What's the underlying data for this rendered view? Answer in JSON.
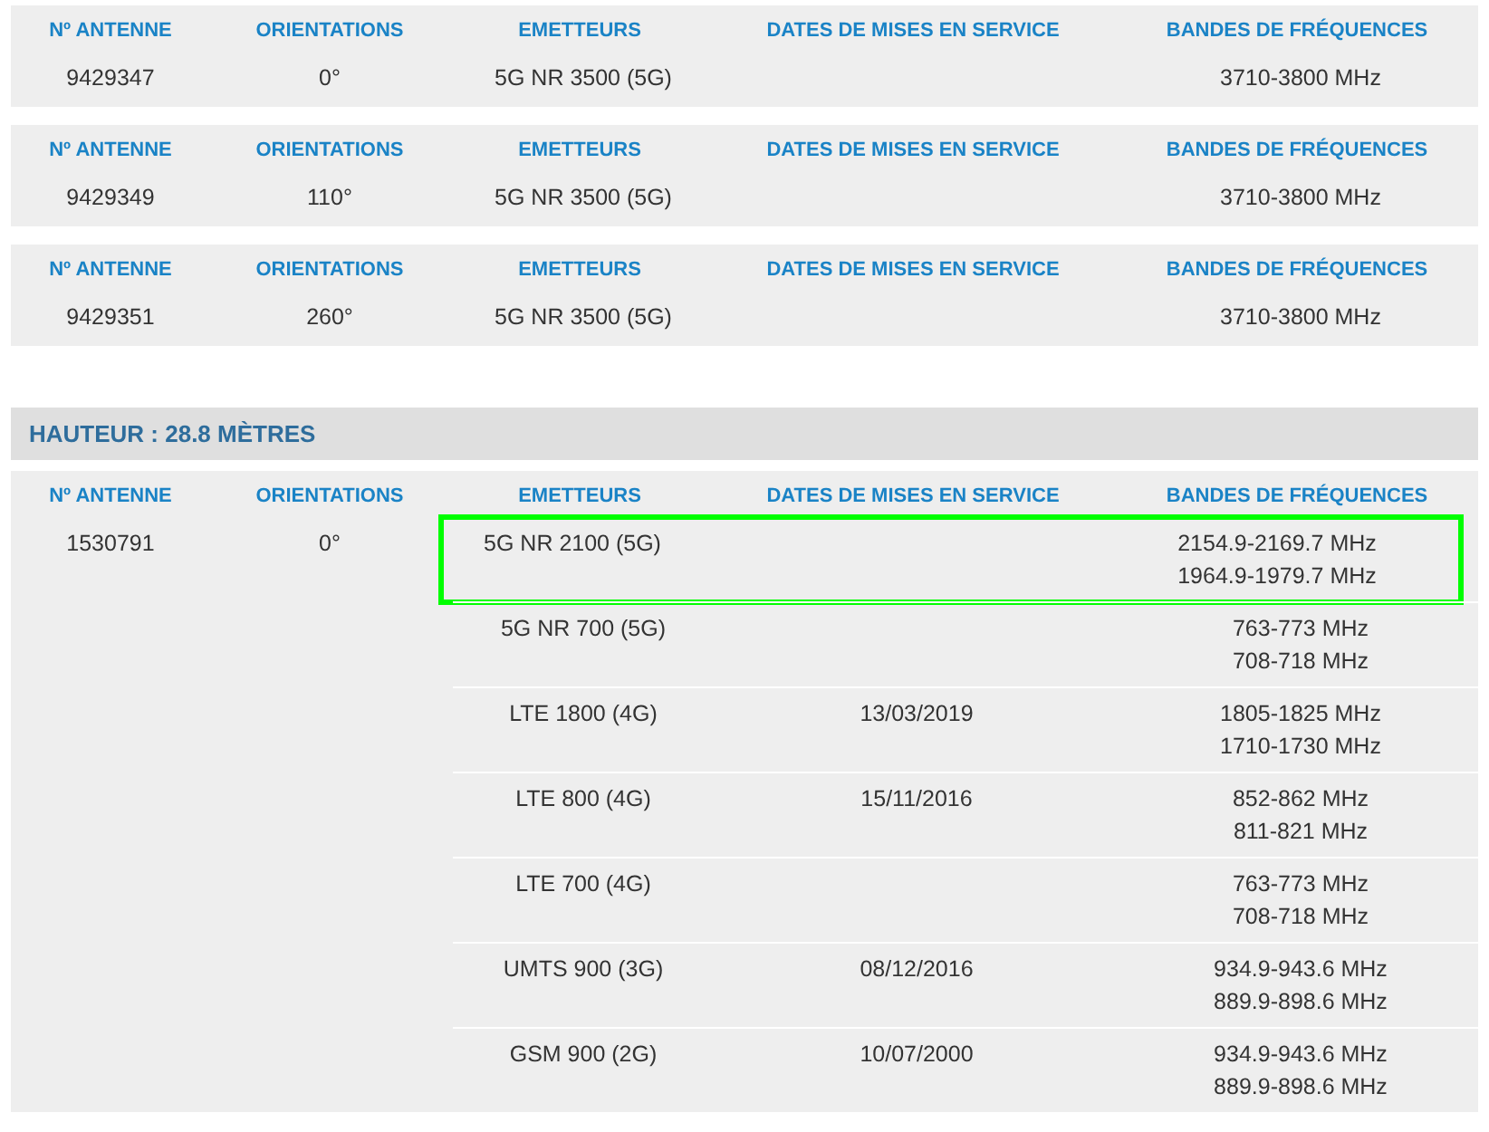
{
  "antenna_tables": [
    {
      "columns": [
        "Nº ANTENNE",
        "ORIENTATIONS",
        "EMETTEURS",
        "DATES DE MISES EN SERVICE",
        "BANDES DE FRÉQUENCES"
      ],
      "antenna": "9429347",
      "orientation": "0°",
      "emitters": [
        {
          "name": "5G NR 3500 (5G)",
          "highlighted": false,
          "bands": [
            "3710-3800 MHz"
          ]
        }
      ]
    },
    {
      "columns": [
        "Nº ANTENNE",
        "ORIENTATIONS",
        "EMETTEURS",
        "DATES DE MISES EN SERVICE",
        "BANDES DE FRÉQUENCES"
      ],
      "antenna": "9429349",
      "orientation": "110°",
      "emitters": [
        {
          "name": "5G NR 3500 (5G)",
          "highlighted": false,
          "bands": [
            "3710-3800 MHz"
          ]
        }
      ]
    },
    {
      "columns": [
        "Nº ANTENNE",
        "ORIENTATIONS",
        "EMETTEURS",
        "DATES DE MISES EN SERVICE",
        "BANDES DE FRÉQUENCES"
      ],
      "antenna": "9429351",
      "orientation": "260°",
      "emitters": [
        {
          "name": "5G NR 3500 (5G)",
          "highlighted": false,
          "bands": [
            "3710-3800 MHz"
          ]
        }
      ]
    }
  ],
  "height_section": {
    "title": "HAUTEUR : 28.8 MÈTRES",
    "tables": [
      {
        "columns": [
          "Nº ANTENNE",
          "ORIENTATIONS",
          "EMETTEURS",
          "DATES DE MISES EN SERVICE",
          "BANDES DE FRÉQUENCES"
        ],
        "antenna": "1530791",
        "orientation": "0°",
        "emitters": [
          {
            "name": "5G NR 2100 (5G)",
            "highlighted": true,
            "bands": [
              "2154.9-2169.7 MHz",
              "1964.9-1979.7 MHz"
            ]
          },
          {
            "name": "5G NR 700 (5G)",
            "highlighted": false,
            "bands": [
              "763-773 MHz",
              "708-718 MHz"
            ]
          },
          {
            "name": "LTE 1800 (4G)",
            "date": "13/03/2019",
            "highlighted": false,
            "bands": [
              "1805-1825 MHz",
              "1710-1730 MHz"
            ]
          },
          {
            "name": "LTE 800 (4G)",
            "date": "15/11/2016",
            "highlighted": false,
            "bands": [
              "852-862 MHz",
              "811-821 MHz"
            ]
          },
          {
            "name": "LTE 700 (4G)",
            "highlighted": false,
            "bands": [
              "763-773 MHz",
              "708-718 MHz"
            ]
          },
          {
            "name": "UMTS 900 (3G)",
            "date": "08/12/2016",
            "highlighted": false,
            "bands": [
              "934.9-943.6 MHz",
              "889.9-898.6 MHz"
            ]
          },
          {
            "name": "GSM 900 (2G)",
            "date": "10/07/2000",
            "highlighted": false,
            "bands": [
              "934.9-943.6 MHz",
              "889.9-898.6 MHz"
            ]
          }
        ]
      }
    ]
  }
}
